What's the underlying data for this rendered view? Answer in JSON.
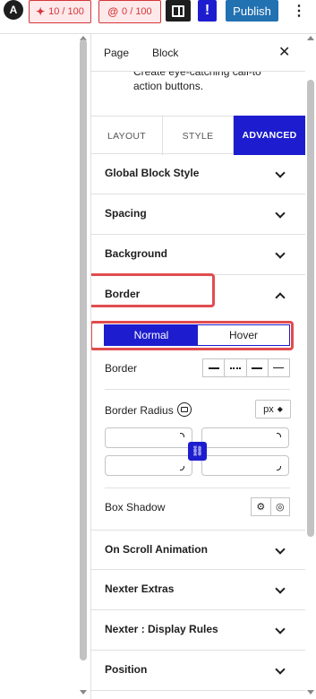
{
  "topbar": {
    "logo": "A",
    "counter1": "10 / 100",
    "counter2": "0 / 100",
    "excl": "!",
    "publish": "Publish",
    "more": "⋮"
  },
  "panel": {
    "tab_page": "Page",
    "tab_block": "Block",
    "close": "✕",
    "description": "Create eye-catching call-to action buttons.",
    "subtabs": {
      "layout": "LAYOUT",
      "style": "STYLE",
      "advanced": "ADVANCED"
    },
    "sections": {
      "global": "Global Block Style",
      "spacing": "Spacing",
      "background": "Background",
      "border": "Border",
      "scroll": "On Scroll Animation",
      "nexter_extras": "Nexter Extras",
      "display_rules": "Nexter : Display Rules",
      "position": "Position"
    },
    "border": {
      "normal": "Normal",
      "hover": "Hover",
      "border_label": "Border",
      "radius_label": "Border Radius",
      "unit": "px",
      "box_shadow_label": "Box Shadow"
    }
  },
  "colors": {
    "accent": "#1d1dcf",
    "highlight": "#e14c4f",
    "publish": "#2271b1"
  }
}
